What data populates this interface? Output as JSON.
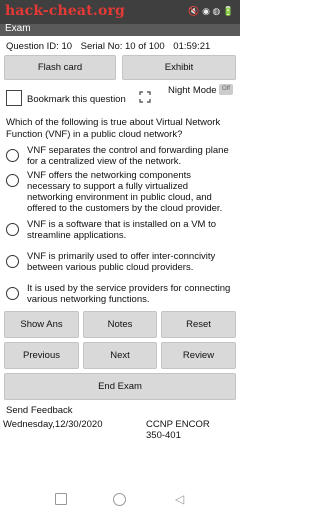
{
  "status_bar": {
    "brand": "hack-cheat.org",
    "icons": "🔇 ◉ ◍ 🔋"
  },
  "app_bar": {
    "title": "Exam"
  },
  "question_info": {
    "id": "Question ID: 10",
    "serial": "Serial No: 10 of 100",
    "time": "01:59:21"
  },
  "tabs": {
    "flash_card": "Flash card",
    "exhibit": "Exhibit"
  },
  "bookmark": {
    "label": "Bookmark this question",
    "checked": false
  },
  "night_mode": {
    "label": "Night Mode",
    "toggle_text": "Off"
  },
  "question": {
    "text": "Which of the following is true about Virtual Network Function (VNF) in a public cloud network?"
  },
  "options": [
    {
      "text": "VNF separates the control and forwarding plane for a centralized view of the network."
    },
    {
      "text": "VNF offers the networking components necessary to support a fully virtualized networking environment in public cloud, and offered to the customers by the cloud provider."
    },
    {
      "text": "VNF is a software that is installed on a VM to streamline applications."
    },
    {
      "text": "VNF is primarily used to offer inter-conncivity between various public cloud providers."
    },
    {
      "text": "It is used by the service providers for connecting various networking functions."
    }
  ],
  "buttons": {
    "show_ans": "Show Ans",
    "notes": "Notes",
    "reset": "Reset",
    "previous": "Previous",
    "next": "Next",
    "review": "Review",
    "end_exam": "End Exam"
  },
  "footer": {
    "send_feedback": "Send Feedback",
    "date": "Wednesday,12/30/2020",
    "exam_name": "CCNP ENCOR",
    "exam_code": "350-401"
  },
  "colors": {
    "brand": "#e53935",
    "status_bar": "#3f3f3f",
    "app_bar": "#5a5a5a",
    "button": "#d9d9d9"
  }
}
